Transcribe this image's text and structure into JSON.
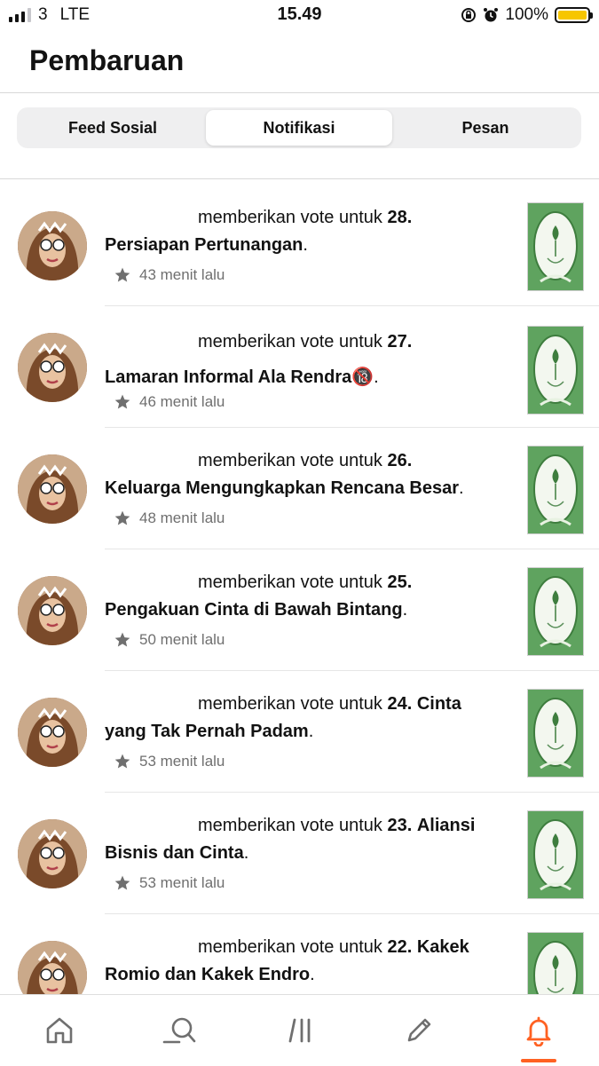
{
  "status_bar": {
    "carrier": "3",
    "network": "LTE",
    "time": "15.49",
    "battery": "100%"
  },
  "header": {
    "title": "Pembaruan"
  },
  "tabs": [
    {
      "label": "Feed Sosial",
      "active": false
    },
    {
      "label": "Notifikasi",
      "active": true
    },
    {
      "label": "Pesan",
      "active": false
    }
  ],
  "notifications": [
    {
      "action": "memberikan vote untuk",
      "chapter": "28.",
      "title": "Persiapan Pertunangan",
      "time": "43 menit lalu"
    },
    {
      "action": "memberikan vote untuk",
      "chapter": "27.",
      "title": "Lamaran Informal Ala Rendra🔞",
      "time": "46 menit lalu"
    },
    {
      "action": "memberikan vote untuk",
      "chapter": "26.",
      "title": "Keluarga Mengungkapkan Rencana Besar",
      "time": "48 menit lalu"
    },
    {
      "action": "memberikan vote untuk",
      "chapter": "25.",
      "title": "Pengakuan Cinta di Bawah Bintang",
      "time": "50 menit lalu"
    },
    {
      "action": "memberikan vote untuk",
      "chapter": "24.",
      "title": "Cinta yang Tak Pernah Padam",
      "time": "53 menit lalu"
    },
    {
      "action": "memberikan vote untuk",
      "chapter": "23.",
      "title": "Aliansi Bisnis dan Cinta",
      "time": "53 menit lalu"
    },
    {
      "action": "memberikan vote untuk",
      "chapter": "22.",
      "title": "Kakek Romio dan Kakek Endro",
      "time": ""
    }
  ],
  "nav": {
    "items": [
      "home-icon",
      "search-icon",
      "library-icon",
      "write-icon",
      "notification-bell-icon"
    ],
    "active": "notification-bell-icon"
  },
  "colors": {
    "accent": "#ff6122",
    "battery": "#f7c600",
    "cover_green": "#5fa35f"
  }
}
